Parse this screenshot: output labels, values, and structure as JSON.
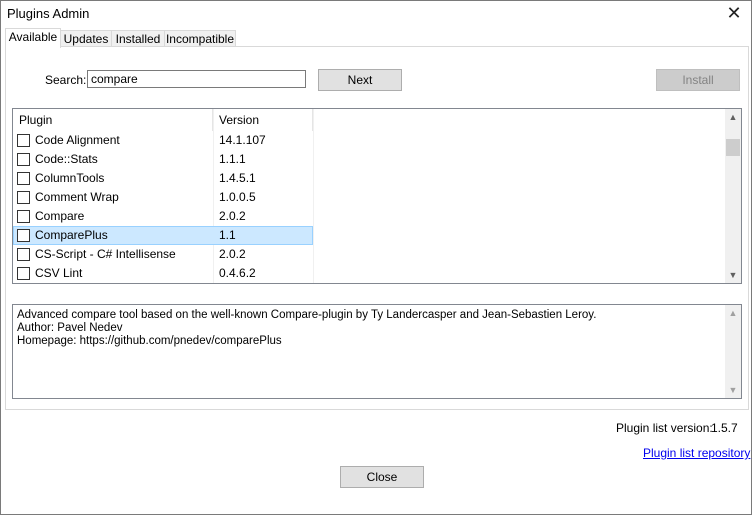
{
  "window": {
    "title": "Plugins Admin"
  },
  "tabs": [
    {
      "label": "Available"
    },
    {
      "label": "Updates"
    },
    {
      "label": "Installed"
    },
    {
      "label": "Incompatible"
    }
  ],
  "search": {
    "label": "Search:",
    "value": "compare"
  },
  "buttons": {
    "next": "Next",
    "install": "Install",
    "close": "Close"
  },
  "plugin_list": {
    "columns": [
      "Plugin",
      "Version"
    ],
    "rows": [
      {
        "name": "Code Alignment",
        "version": "14.1.107",
        "checked": false
      },
      {
        "name": "Code::Stats",
        "version": "1.1.1",
        "checked": false
      },
      {
        "name": "ColumnTools",
        "version": "1.4.5.1",
        "checked": false
      },
      {
        "name": "Comment Wrap",
        "version": "1.0.0.5",
        "checked": false
      },
      {
        "name": "Compare",
        "version": "2.0.2",
        "checked": false
      },
      {
        "name": "ComparePlus",
        "version": "1.1",
        "checked": false,
        "selected": true
      },
      {
        "name": "CS-Script - C# Intellisense",
        "version": "2.0.2",
        "checked": false
      },
      {
        "name": "CSV Lint",
        "version": "0.4.6.2",
        "checked": false
      }
    ]
  },
  "description": {
    "line1": "Advanced compare tool based on the well-known Compare-plugin by Ty Landercasper and Jean-Sebastien Leroy.",
    "line2": "Author: Pavel Nedev",
    "line3": "Homepage: https://github.com/pnedev/comparePlus"
  },
  "footer": {
    "version_label": "Plugin list version:",
    "version_value": "1.5.7",
    "repo_link": "Plugin list repository"
  },
  "colors": {
    "selection": "#cce8ff",
    "link": "#0000ee"
  }
}
